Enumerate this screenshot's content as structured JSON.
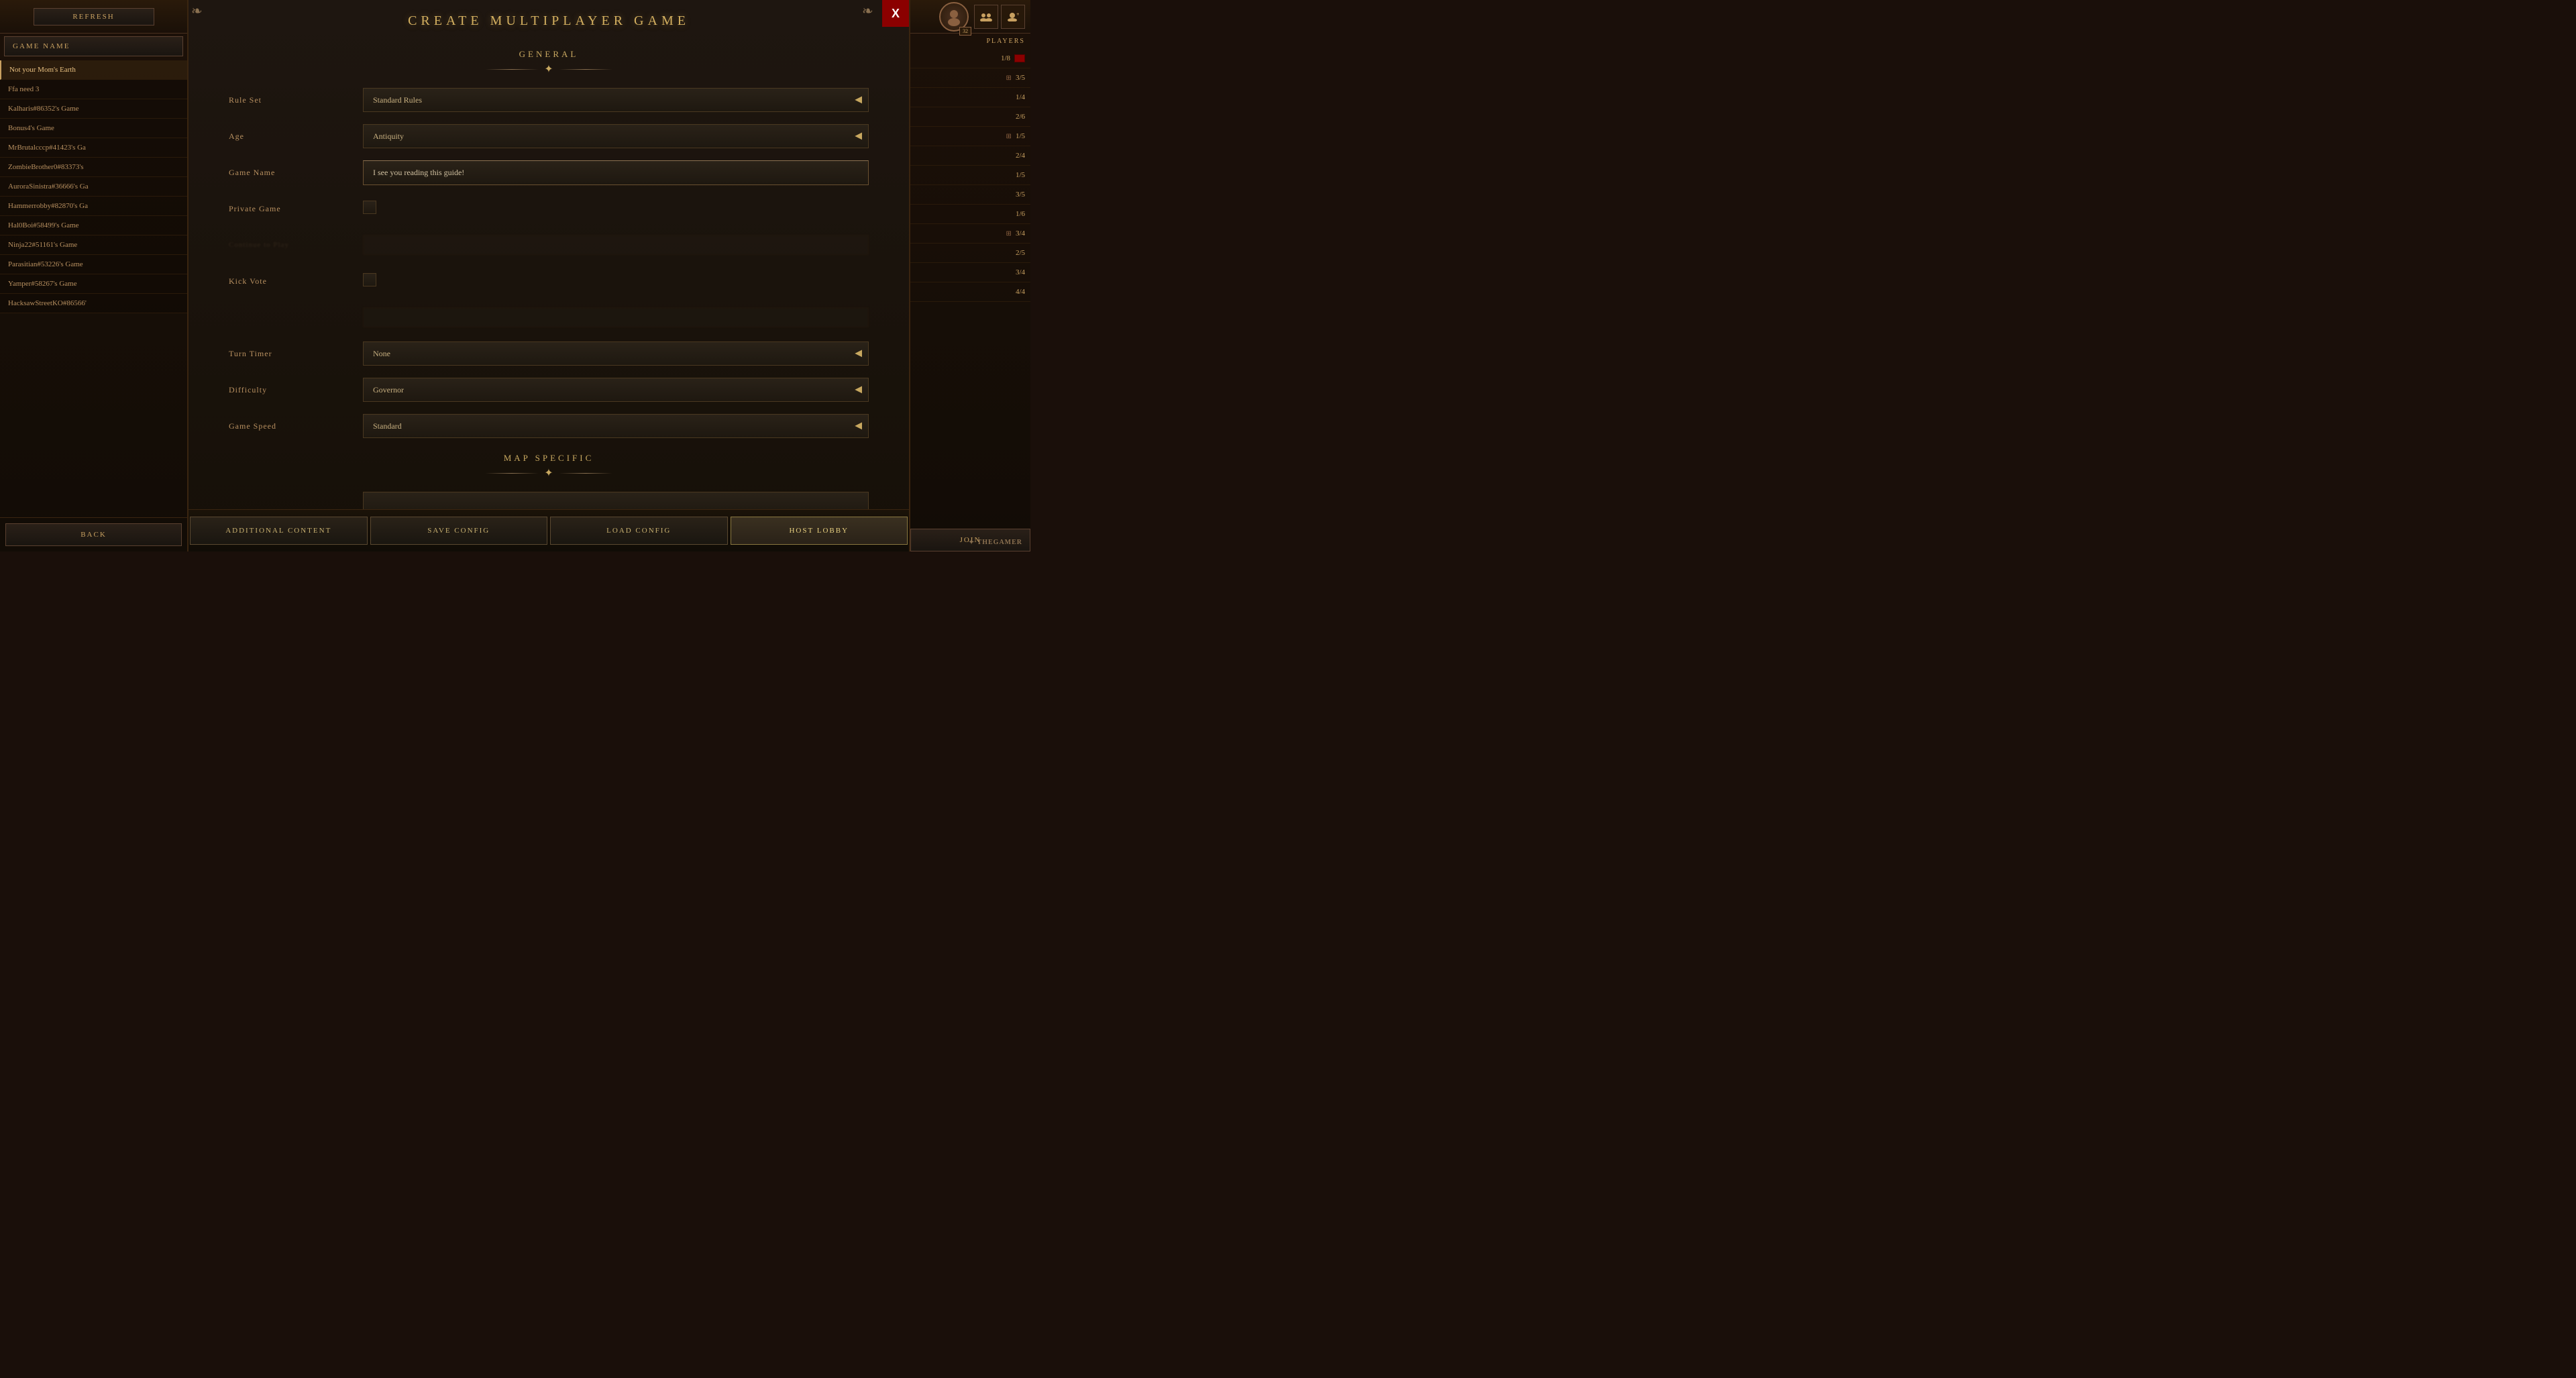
{
  "page": {
    "title": "Create Multiplayer Game"
  },
  "left_sidebar": {
    "refresh_label": "REFRESH",
    "game_name_header": "GAME NAME",
    "games": [
      {
        "name": "Not your Mom's Earth",
        "selected": true
      },
      {
        "name": "Ffa need 3",
        "selected": false
      },
      {
        "name": "Kalharis#86352's Game",
        "selected": false
      },
      {
        "name": "Bonus4's Game",
        "selected": false
      },
      {
        "name": "MrBrutalcccp#41423's Ga",
        "selected": false
      },
      {
        "name": "ZombieBrother0#83373's",
        "selected": false
      },
      {
        "name": "AuroraSinistra#36666's Ga",
        "selected": false
      },
      {
        "name": "Hammerrobby#82870's Ga",
        "selected": false
      },
      {
        "name": "Hal0Boi#58499's Game",
        "selected": false
      },
      {
        "name": "Ninja22#51161's Game",
        "selected": false
      },
      {
        "name": "Parasitian#53226's Game",
        "selected": false
      },
      {
        "name": "Yamper#58267's Game",
        "selected": false
      },
      {
        "name": "HacksawStreetKO#86566'",
        "selected": false
      }
    ],
    "back_label": "BACK"
  },
  "right_sidebar": {
    "players_header": "PLAYERS",
    "player_counts": [
      {
        "count": "1/8",
        "has_flag": true
      },
      {
        "count": "3/5",
        "has_expand": true
      },
      {
        "count": "1/4",
        "has_flag": false
      },
      {
        "count": "2/6",
        "has_flag": false
      },
      {
        "count": "1/5",
        "has_expand": true
      },
      {
        "count": "2/4",
        "has_flag": false
      },
      {
        "count": "1/5",
        "has_flag": false
      },
      {
        "count": "3/5",
        "has_flag": false
      },
      {
        "count": "1/6",
        "has_flag": false
      },
      {
        "count": "3/4",
        "has_expand": true
      },
      {
        "count": "2/5",
        "has_flag": false
      },
      {
        "count": "3/4",
        "has_flag": false
      },
      {
        "count": "4/4",
        "has_flag": false
      }
    ],
    "avatar_level": "32",
    "join_label": "JOIN"
  },
  "modal": {
    "title": "CREATE MULTIPLAYER GAME",
    "close_label": "X",
    "sections": {
      "general": {
        "title": "GENERAL",
        "fields": {
          "rule_set": {
            "label": "Rule Set",
            "value": "Standard Rules",
            "type": "select"
          },
          "age": {
            "label": "Age",
            "value": "Antiquity",
            "type": "select"
          },
          "game_name": {
            "label": "Game Name",
            "value": "I see you reading this guide!",
            "type": "text"
          },
          "private_game": {
            "label": "Private Game",
            "type": "checkbox"
          },
          "kick_vote": {
            "label": "Kick Vote",
            "type": "checkbox"
          },
          "turn_timer": {
            "label": "Turn Timer",
            "value": "None",
            "type": "select"
          },
          "difficulty": {
            "label": "Difficulty",
            "value": "Governor",
            "type": "select"
          },
          "game_speed": {
            "label": "Game Speed",
            "value": "Standard",
            "type": "select"
          }
        }
      },
      "map_specific": {
        "title": "MAP SPECIFIC"
      }
    },
    "footer": {
      "additional_content": "ADDITIONAL CONTENT",
      "save_config": "SAVE CONFIG",
      "load_config": "LOAD CONFIG",
      "host_lobby": "HOST LOBBY"
    }
  },
  "watermark": {
    "text": "THEGAMER"
  }
}
